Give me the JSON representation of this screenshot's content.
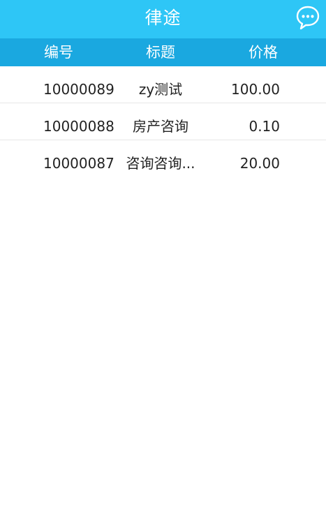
{
  "header": {
    "title": "律途",
    "chat_icon": "chat-bubble-icon"
  },
  "columns": {
    "id": "编号",
    "title": "标题",
    "price": "价格"
  },
  "rows": [
    {
      "id": "10000089",
      "title": "zy测试",
      "price": "100.00"
    },
    {
      "id": "10000088",
      "title": "房产咨询",
      "price": "0.10"
    },
    {
      "id": "10000087",
      "title": "咨询咨询...",
      "price": "20.00"
    }
  ],
  "colors": {
    "topbar": "#2ec6f6",
    "table_header": "#1aa8e0",
    "text": "#222222"
  }
}
